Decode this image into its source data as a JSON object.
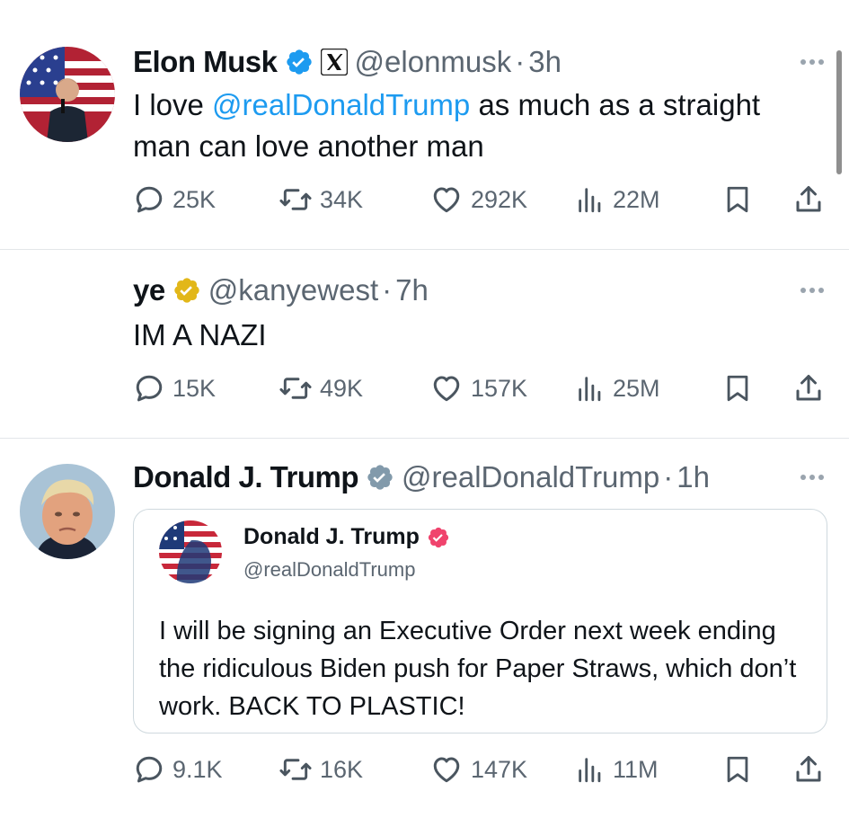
{
  "tweets": [
    {
      "name": "Elon Musk",
      "handle": "@elonmusk",
      "separator": "·",
      "time": "3h",
      "text_before": "I love ",
      "mention": "@realDonaldTrump",
      "text_after": " as much as a straight man can love another man",
      "stats": {
        "replies": "25K",
        "reposts": "34K",
        "likes": "292K",
        "views": "22M"
      }
    },
    {
      "name": "ye",
      "handle": "@kanyewest",
      "separator": "·",
      "time": "7h",
      "text": "IM A NAZI",
      "stats": {
        "replies": "15K",
        "reposts": "49K",
        "likes": "157K",
        "views": "25M"
      }
    },
    {
      "name": "Donald J. Trump",
      "handle": "@realDonaldTrump",
      "separator": "·",
      "time": "1h",
      "quote": {
        "name": "Donald J. Trump",
        "handle": "@realDonaldTrump",
        "text": "I will be signing an Executive Order next week ending the ridiculous Biden push for Paper Straws, which don’t work. BACK TO PLASTIC!"
      },
      "stats": {
        "replies": "9.1K",
        "reposts": "16K",
        "likes": "147K",
        "views": "11M"
      }
    }
  ],
  "icons": {
    "reply": "speech-bubble",
    "repost": "repost-arrows",
    "like": "heart",
    "views": "bar-chart",
    "bookmark": "bookmark",
    "share": "share-upload",
    "more": "horizontal-ellipsis",
    "verified_blue": "verified-badge",
    "verified_gold": "verified-badge-gold",
    "verified_gray": "verified-badge-gray",
    "verified_pink": "verified-badge-pink",
    "affiliate": "x-logo"
  },
  "colors": {
    "accent": "#1d9bf0",
    "muted": "#5b6671",
    "text": "#0f1419",
    "verified_blue": "#1d9bf0",
    "verified_gold": "#e2b719",
    "verified_gray": "#829aab",
    "verified_pink": "#f0436d"
  }
}
